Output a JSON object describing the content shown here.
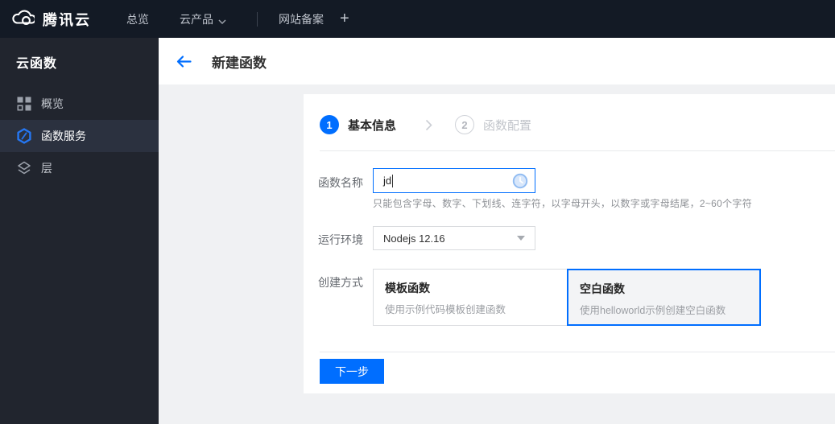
{
  "colors": {
    "accent": "#006eff",
    "topbar_bg": "#131a25",
    "sidebar_bg": "#21252e",
    "content_bg": "#f0f1f3"
  },
  "topbar": {
    "brand": "腾讯云",
    "nav": [
      {
        "label": "总览"
      },
      {
        "label": "云产品"
      },
      {
        "label": "网站备案"
      }
    ],
    "add_tab": "+"
  },
  "sidebar": {
    "title": "云函数",
    "items": [
      {
        "label": "概览",
        "icon": "overview-grid-icon",
        "active": false
      },
      {
        "label": "函数服务",
        "icon": "function-service-hexagon-icon",
        "active": true
      },
      {
        "label": "层",
        "icon": "layers-icon",
        "active": false
      }
    ]
  },
  "header": {
    "title": "新建函数"
  },
  "wizard": {
    "steps": [
      {
        "number": "1",
        "label": "基本信息",
        "active": true
      },
      {
        "number": "2",
        "label": "函数配置",
        "active": false
      }
    ]
  },
  "form": {
    "name_row": {
      "label": "函数名称",
      "value": "jd",
      "hint": "只能包含字母、数字、下划线、连字符，以字母开头，以数字或字母结尾，2~60个字符"
    },
    "runtime_row": {
      "label": "运行环境",
      "value": "Nodejs 12.16"
    },
    "method_row": {
      "label": "创建方式",
      "options": [
        {
          "title": "模板函数",
          "desc": "使用示例代码模板创建函数",
          "selected": false
        },
        {
          "title": "空白函数",
          "desc": "使用helloworld示例创建空白函数",
          "selected": true
        }
      ]
    },
    "next_button": "下一步"
  }
}
